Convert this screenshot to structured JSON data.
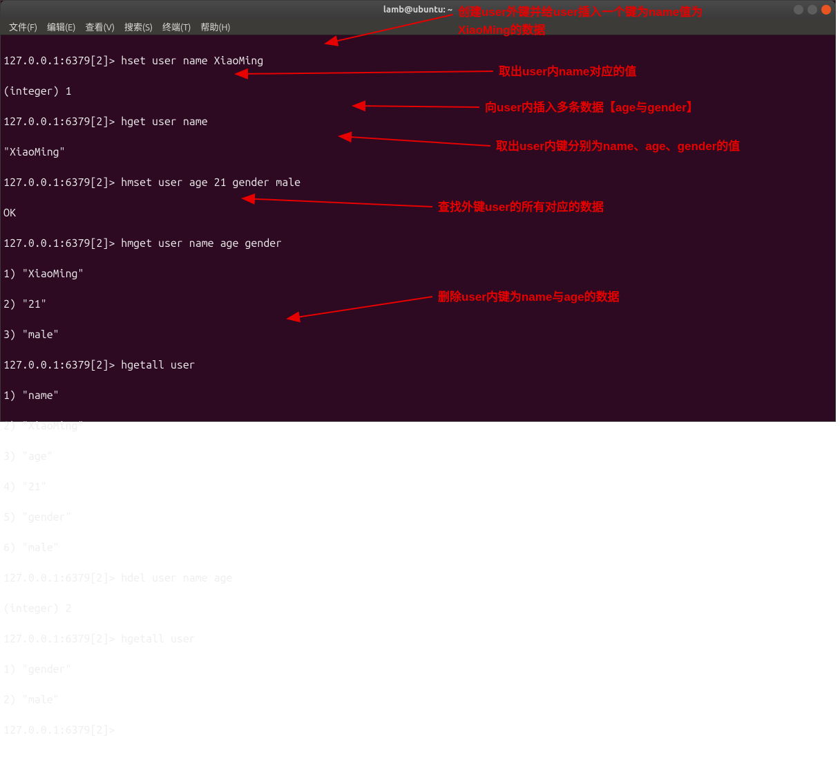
{
  "window": {
    "title": "lamb@ubuntu: ~"
  },
  "menu": {
    "file": "文件(F)",
    "edit": "编辑(E)",
    "view": "查看(V)",
    "search": "搜索(S)",
    "terminal": "终端(T)",
    "help": "帮助(H)"
  },
  "lines": {
    "l0": "127.0.0.1:6379[2]> hset user name XiaoMing",
    "l1": "(integer) 1",
    "l2": "127.0.0.1:6379[2]> hget user name",
    "l3": "\"XiaoMing\"",
    "l4": "127.0.0.1:6379[2]> hmset user age 21 gender male",
    "l5": "OK",
    "l6": "127.0.0.1:6379[2]> hmget user name age gender",
    "l7": "1) \"XiaoMing\"",
    "l8": "2) \"21\"",
    "l9": "3) \"male\"",
    "l10": "127.0.0.1:6379[2]> hgetall user",
    "l11": "1) \"name\"",
    "l12": "2) \"XiaoMing\"",
    "l13": "3) \"age\"",
    "l14": "4) \"21\"",
    "l15": "5) \"gender\"",
    "l16": "6) \"male\"",
    "l17": "127.0.0.1:6379[2]> hdel user name age",
    "l18": "(integer) 2",
    "l19": "127.0.0.1:6379[2]> hgetall user",
    "l20": "1) \"gender\"",
    "l21": "2) \"male\"",
    "l22": "127.0.0.1:6379[2]> "
  },
  "annotations": {
    "a1": "创建user外键并给user插入一个键为name值为",
    "a1b": "XiaoMing的数据",
    "a2": "取出user内name对应的值",
    "a3": "向user内插入多条数据【age与gender】",
    "a4": "取出user内键分别为name、age、gender的值",
    "a5": "查找外键user的所有对应的数据",
    "a6": "删除user内键为name与age的数据"
  },
  "colors": {
    "annotation": "#e60000",
    "terminal_bg": "#2d0a22",
    "terminal_fg": "#ffffff"
  },
  "icons": {
    "minimize": "minimize-icon",
    "maximize": "maximize-icon",
    "close": "close-icon"
  }
}
